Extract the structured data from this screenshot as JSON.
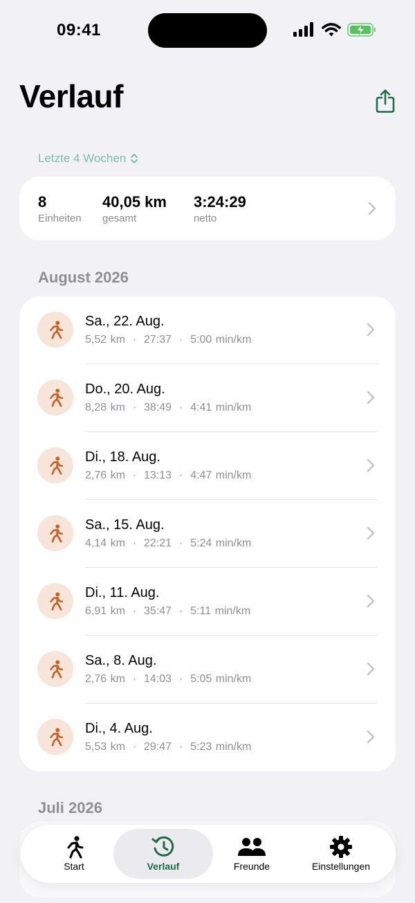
{
  "status_bar": {
    "time": "09:41"
  },
  "header": {
    "title": "Verlauf",
    "share_icon": "share-icon"
  },
  "range": {
    "label": "Letzte 4 Wochen",
    "icon": "chevron-up-down-icon"
  },
  "summary": {
    "sessions": {
      "value": "8",
      "label": "Einheiten"
    },
    "distance": {
      "value": "40,05 km",
      "label": "gesamt"
    },
    "duration": {
      "value": "3:24:29",
      "label": "netto"
    }
  },
  "sections": [
    {
      "title": "August 2026",
      "runs": [
        {
          "date": "Sa., 22. Aug.",
          "distance": "5,52 km",
          "time": "27:37",
          "pace": "5:00 min/km"
        },
        {
          "date": "Do., 20. Aug.",
          "distance": "8,28 km",
          "time": "38:49",
          "pace": "4:41 min/km"
        },
        {
          "date": "Di., 18. Aug.",
          "distance": "2,76 km",
          "time": "13:13",
          "pace": "4:47 min/km"
        },
        {
          "date": "Sa., 15. Aug.",
          "distance": "4,14 km",
          "time": "22:21",
          "pace": "5:24 min/km"
        },
        {
          "date": "Di., 11. Aug.",
          "distance": "6,91 km",
          "time": "35:47",
          "pace": "5:11 min/km"
        },
        {
          "date": "Sa., 8. Aug.",
          "distance": "2,76 km",
          "time": "14:03",
          "pace": "5:05 min/km"
        },
        {
          "date": "Di., 4. Aug.",
          "distance": "5,53 km",
          "time": "29:47",
          "pace": "5:23 min/km"
        }
      ]
    },
    {
      "title": "Juli 2026"
    }
  ],
  "tabs": [
    {
      "label": "Start",
      "icon": "runner-icon",
      "active": false
    },
    {
      "label": "Verlauf",
      "icon": "history-icon",
      "active": true
    },
    {
      "label": "Freunde",
      "icon": "friends-icon",
      "active": false
    },
    {
      "label": "Einstellungen",
      "icon": "gear-icon",
      "active": false
    }
  ],
  "colors": {
    "accent": "#1f6b43",
    "range_text": "#7bbfa6",
    "run_icon": "#c8622a",
    "run_icon_bg": "#f7e5da",
    "background": "#f2f2f6"
  }
}
